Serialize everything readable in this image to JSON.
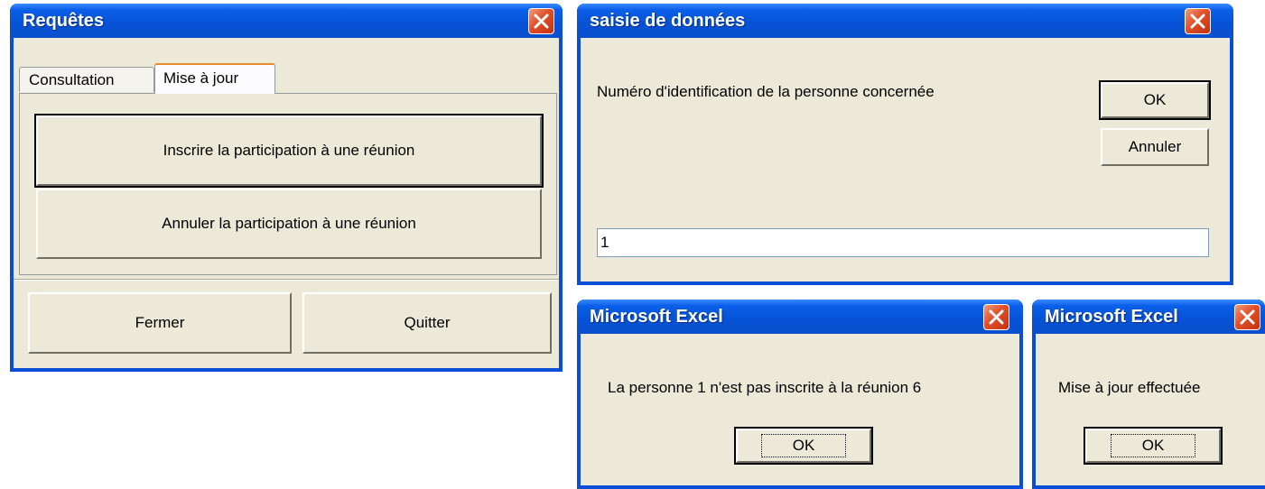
{
  "requetes": {
    "title": "Requêtes",
    "tabs": [
      "Consultation",
      "Mise à jour"
    ],
    "active_tab": "Mise à jour",
    "btn_inscrire": "Inscrire la participation à une réunion",
    "btn_annuler": "Annuler la participation à une réunion",
    "btn_fermer": "Fermer",
    "btn_quitter": "Quitter"
  },
  "saisie": {
    "title": "saisie de données",
    "prompt": "Numéro d'identification de la personne concernée",
    "ok": "OK",
    "cancel": "Annuler",
    "input_value": "1"
  },
  "msg1": {
    "title": "Microsoft Excel",
    "message": "La personne 1 n'est pas inscrite à la réunion 6",
    "ok": "OK"
  },
  "msg2": {
    "title": "Microsoft Excel",
    "message": "Mise à jour effectuée",
    "ok": "OK"
  },
  "icons": {
    "close": "close-icon"
  },
  "colors": {
    "titlebar": "#0a53d8",
    "face": "#ece9d8",
    "close": "#e0502a"
  }
}
